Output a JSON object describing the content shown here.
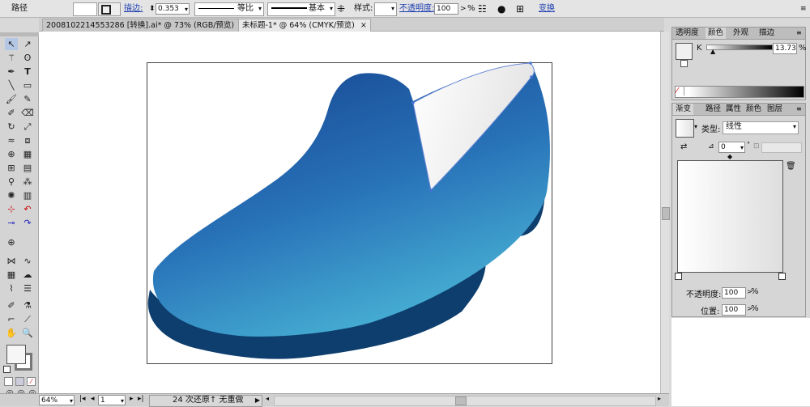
{
  "control_bar": {
    "object_type": "路径",
    "stroke_label": "描边:",
    "stroke_weight": "0.353",
    "profile_label": "等比",
    "brush_label": "基本",
    "style_label": "样式:",
    "opacity_label": "不透明度:",
    "opacity_value": "100",
    "opacity_unit": "%",
    "transform_label": "变换"
  },
  "tabs": [
    {
      "label": "2008102214553286 [转换].ai* @ 73% (RGB/预览)"
    },
    {
      "label": "未标题-1* @ 64% (CMYK/预览)"
    }
  ],
  "color_panel": {
    "tabs": [
      "透明度",
      "颜色",
      "外观",
      "描边"
    ],
    "channel_label": "K",
    "k_value": "13.73",
    "k_unit": "%"
  },
  "gradient_panel": {
    "tabs": [
      "渐变",
      "路径",
      "属性",
      "颜色",
      "图层"
    ],
    "type_label": "类型:",
    "type_value": "线性",
    "angle_value": "0",
    "opacity_label": "不透明度:",
    "opacity_value": "100",
    "opacity_unit": "%",
    "location_label": "位置:",
    "location_value": "100",
    "location_unit": "%"
  },
  "status_bar": {
    "zoom": "64%",
    "page": "1",
    "history_text": "24 次还原↑ 无重做"
  },
  "colors": {
    "shoe_dark": "#1a4f99",
    "shoe_light": "#4ab6d6",
    "sole": "#0d3e6e",
    "accent_ink": "#1f3fb0"
  }
}
